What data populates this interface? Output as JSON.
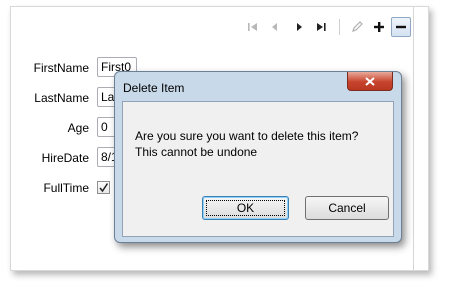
{
  "toolbar": {
    "first_icon": "first-record-icon",
    "prev_icon": "previous-record-icon",
    "next_icon": "next-record-icon",
    "last_icon": "last-record-icon",
    "edit_icon": "pencil-icon",
    "add_icon": "plus-icon",
    "delete_icon": "minus-icon"
  },
  "form": {
    "first_name": {
      "label": "FirstName",
      "value": "First0"
    },
    "last_name": {
      "label": "LastName",
      "value": "La"
    },
    "age": {
      "label": "Age",
      "value": "0"
    },
    "hire_date": {
      "label": "HireDate",
      "value": "8/1"
    },
    "full_time": {
      "label": "FullTime",
      "checked": true
    }
  },
  "dialog": {
    "title": "Delete Item",
    "message_line1": "Are you sure you want to delete this item?",
    "message_line2": "This cannot be undone",
    "ok_label": "OK",
    "cancel_label": "Cancel",
    "close_icon": "close-icon"
  },
  "colors": {
    "dialog_frame": "#c8d9ea",
    "close_button": "#c7432c",
    "ok_focus_border": "#3c7fb1"
  }
}
